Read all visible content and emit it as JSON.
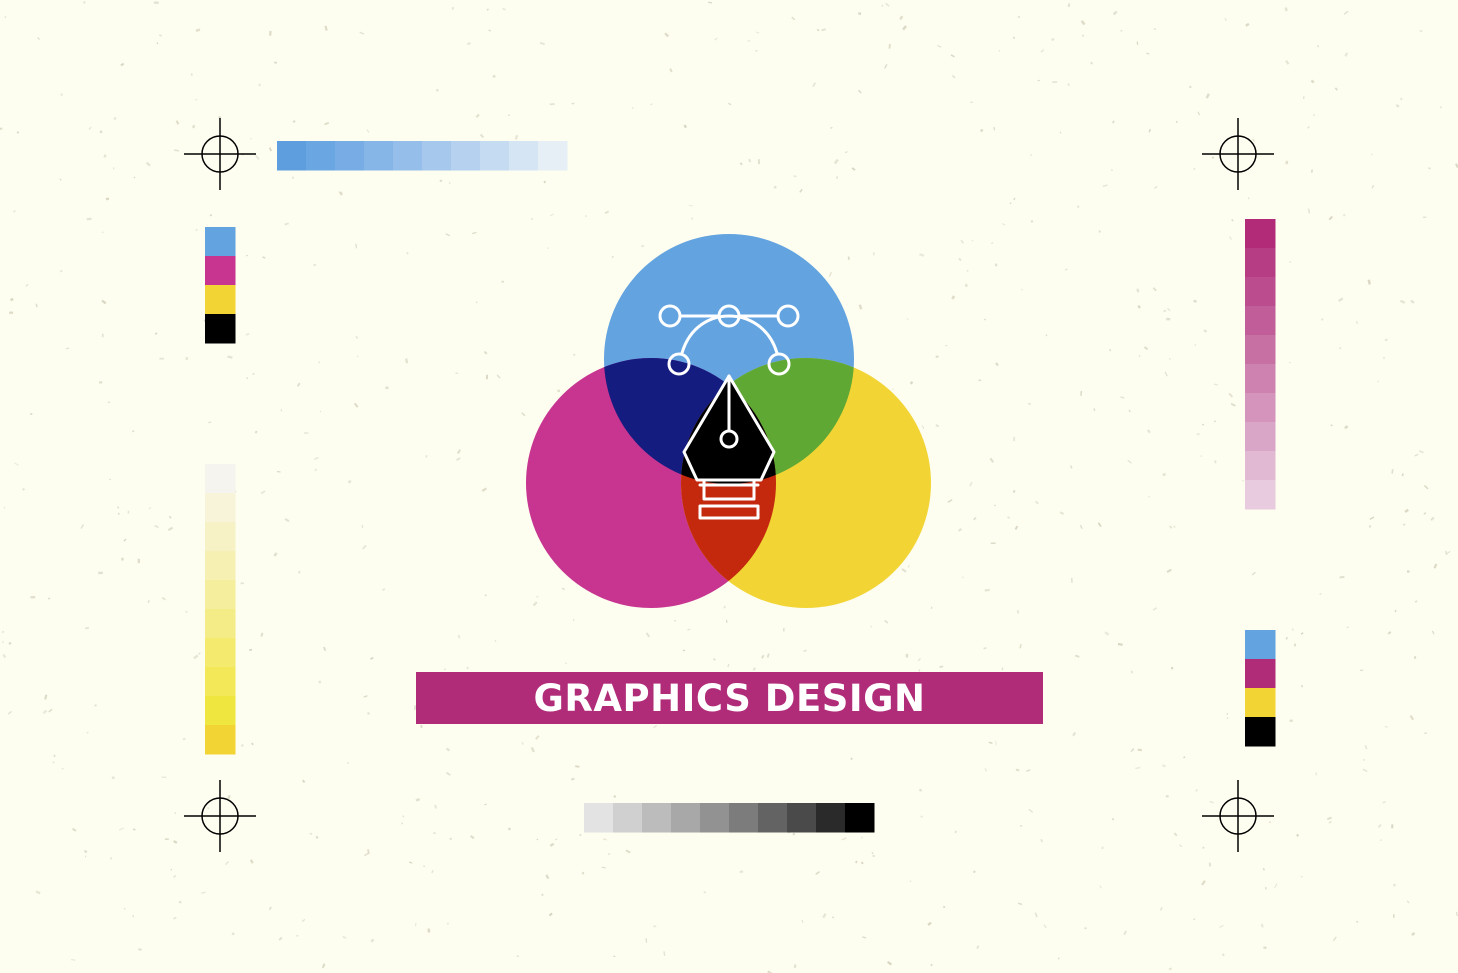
{
  "title": "GRAPHICS DESIGN",
  "colors": {
    "background": "#fdfdf0",
    "banner": "#b02b78",
    "cyan": "#62a3e0",
    "magenta": "#c73590",
    "yellow": "#f2d535",
    "black": "#000000",
    "overlap_blue_magenta": "#141c80",
    "overlap_blue_yellow": "#5fa834",
    "overlap_magenta_yellow": "#c4290d",
    "icon_stroke": "#ffffff"
  },
  "swatches": {
    "top_blue": [
      "#5e9edf",
      "#6aa6e2",
      "#77ade4",
      "#86b6e7",
      "#95bfea",
      "#a5c8ec",
      "#b5d1ef",
      "#c5dbf2",
      "#d6e5f4",
      "#e6eef6"
    ],
    "left_cmyk": [
      "#62a3e0",
      "#c73590",
      "#f2d535",
      "#000000"
    ],
    "left_yellow": [
      "#f5f4ef",
      "#f8f4d9",
      "#f7f2c6",
      "#f6f0b2",
      "#f5ee9c",
      "#f4ec86",
      "#f3ea6e",
      "#f2e858",
      "#f0e640",
      "#f2d535"
    ],
    "right_magenta": [
      "#b12b78",
      "#b63c83",
      "#bb4c8d",
      "#c15e99",
      "#c770a4",
      "#cd82b0",
      "#d494bb",
      "#daa6c7",
      "#e1b9d3",
      "#e8cbde"
    ],
    "right_cmyk": [
      "#62a3e0",
      "#b02b78",
      "#f2d535",
      "#000000"
    ],
    "bottom_gray": [
      "#e3e3e3",
      "#d0d0d0",
      "#bcbcbc",
      "#a8a8a8",
      "#929292",
      "#7c7c7c",
      "#636363",
      "#4a4a4a",
      "#2a2a2a",
      "#000000"
    ]
  },
  "icons": [
    "registration-mark-icon",
    "pen-tool-icon",
    "bezier-curve-icon"
  ]
}
